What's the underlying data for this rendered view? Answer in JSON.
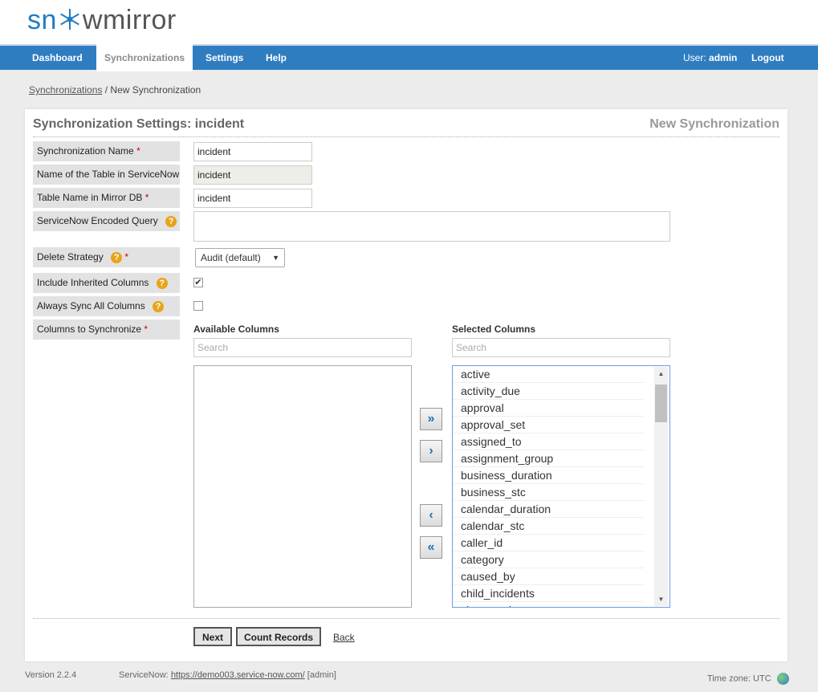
{
  "header": {
    "logo_left": "sn",
    "logo_right": "wmirror"
  },
  "nav": {
    "items": [
      "Dashboard",
      "Synchronizations",
      "Settings",
      "Help"
    ],
    "user_prefix": "User:",
    "user_name": "admin",
    "logout": "Logout"
  },
  "breadcrumb": {
    "link": "Synchronizations",
    "separator": "/",
    "current": "New Synchronization"
  },
  "panel": {
    "title": "Synchronization Settings: incident",
    "subtitle": "New Synchronization"
  },
  "form": {
    "sync_name_label": "Synchronization Name",
    "sync_name_value": "incident",
    "table_sn_label": "Name of the Table in ServiceNow",
    "table_sn_value": "incident",
    "table_db_label": "Table Name in Mirror DB",
    "table_db_value": "incident",
    "query_label": "ServiceNow Encoded Query",
    "query_value": "",
    "delete_label": "Delete Strategy",
    "delete_value": "Audit (default)",
    "inherited_label": "Include Inherited Columns",
    "inherited_checked": true,
    "always_label": "Always Sync All Columns",
    "always_checked": false,
    "columns_label": "Columns to Synchronize",
    "required_mark": "*",
    "help_mark": "?"
  },
  "columns": {
    "available_heading": "Available Columns",
    "selected_heading": "Selected Columns",
    "search_placeholder": "Search",
    "available": [],
    "selected": [
      "active",
      "activity_due",
      "approval",
      "approval_set",
      "assigned_to",
      "assignment_group",
      "business_duration",
      "business_stc",
      "calendar_duration",
      "calendar_stc",
      "caller_id",
      "category",
      "caused_by",
      "child_incidents",
      "close_code"
    ]
  },
  "buttons": {
    "next": "Next",
    "count": "Count Records",
    "back": "Back"
  },
  "footer": {
    "version": "Version 2.2.4",
    "sn_label": "ServiceNow:",
    "sn_url": "https://demo003.service-now.com/",
    "sn_user": "[admin]",
    "timezone": "Time zone: UTC"
  },
  "colors": {
    "brand_blue": "#2f7dc1",
    "help_orange": "#e8a317",
    "required_red": "#cc0000"
  },
  "icons": {
    "move_all_right": "double-chevron-right-icon",
    "move_right": "chevron-right-icon",
    "move_left": "chevron-left-icon",
    "move_all_left": "double-chevron-left-icon",
    "timezone": "globe-icon",
    "help": "question-icon"
  }
}
